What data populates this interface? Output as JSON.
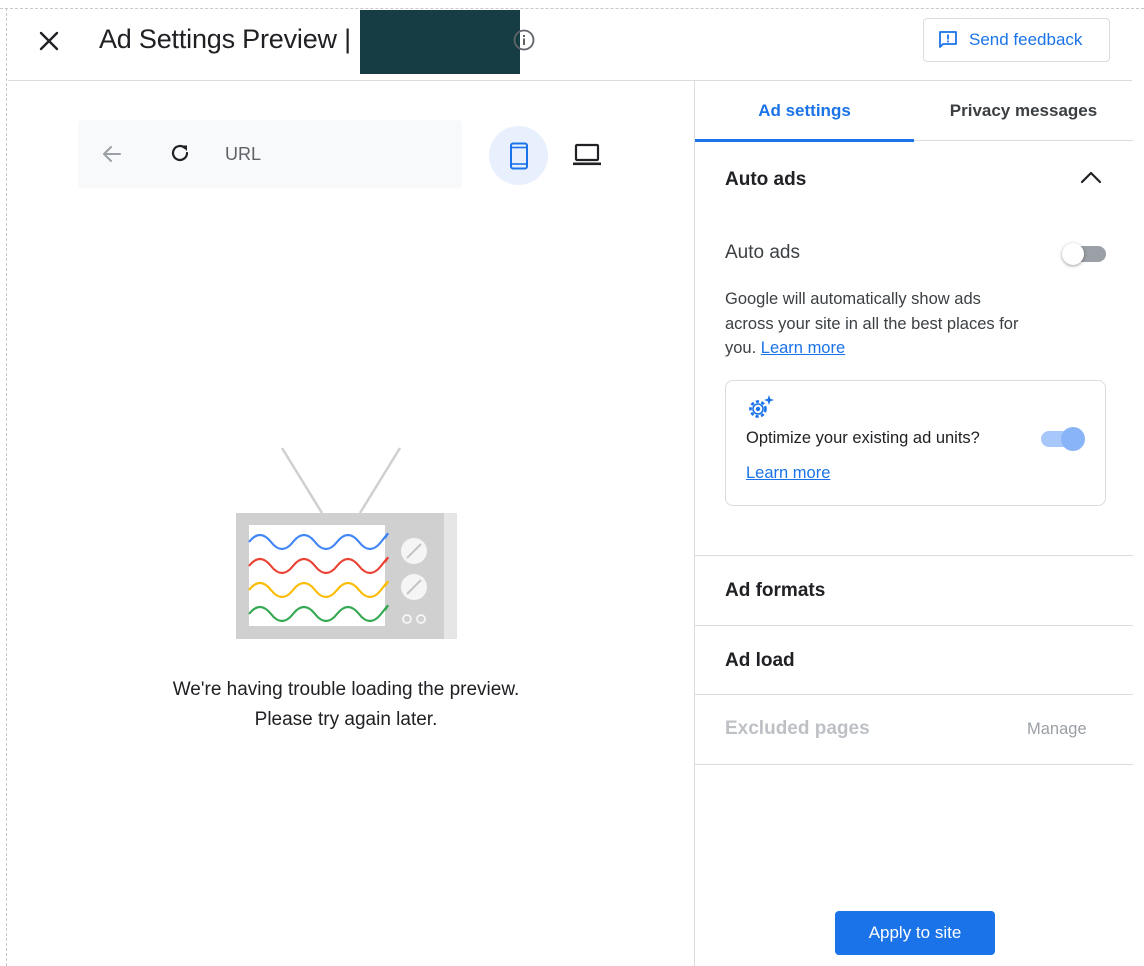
{
  "header": {
    "title": "Ad Settings Preview | r",
    "feedback_label": "Send feedback"
  },
  "preview": {
    "url_placeholder": "URL",
    "error_line1": "We're having trouble loading the preview.",
    "error_line2": "Please try again later."
  },
  "tabs": [
    {
      "label": "Ad settings",
      "active": true
    },
    {
      "label": "Privacy messages",
      "active": false
    }
  ],
  "auto_ads_section": {
    "title": "Auto ads",
    "toggle_label": "Auto ads",
    "toggle_on": false,
    "description": "Google will automatically show ads across your site in all the best places for you.",
    "learn_more": "Learn more",
    "optimize": {
      "text": "Optimize your existing ad units?",
      "learn_more": "Learn more",
      "toggle_on": true
    }
  },
  "sections": {
    "ad_formats": "Ad formats",
    "ad_load": "Ad load",
    "excluded_pages": "Excluded pages",
    "manage": "Manage"
  },
  "apply_label": "Apply to site",
  "colors": {
    "accent": "#1a73e8",
    "redaction": "#163c44",
    "wave_blue": "#4285f4",
    "wave_red": "#ea4335",
    "wave_yellow": "#fbbc04",
    "wave_green": "#34a853"
  }
}
